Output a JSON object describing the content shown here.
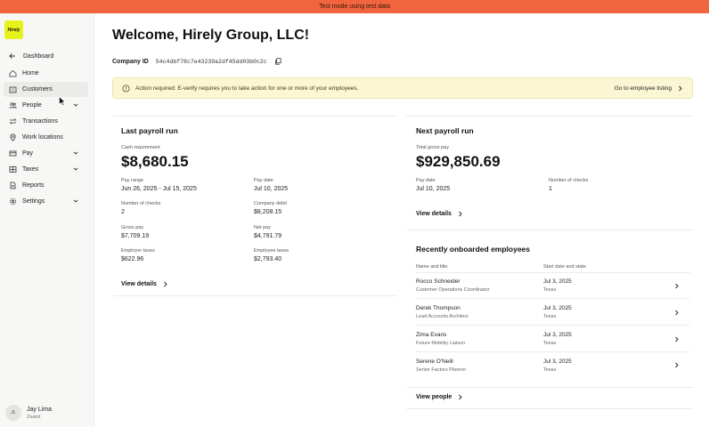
{
  "banner": "Test mode using test data",
  "logo_text": "Hirely",
  "sidebar": {
    "back_label": "Dashboard",
    "items": [
      {
        "label": "Home",
        "icon": "home-icon"
      },
      {
        "label": "Customers",
        "icon": "building-icon"
      },
      {
        "label": "People",
        "icon": "people-icon"
      },
      {
        "label": "Transactions",
        "icon": "transactions-icon"
      },
      {
        "label": "Work locations",
        "icon": "location-icon"
      },
      {
        "label": "Pay",
        "icon": "pay-icon"
      },
      {
        "label": "Taxes",
        "icon": "taxes-icon"
      },
      {
        "label": "Reports",
        "icon": "reports-icon"
      },
      {
        "label": "Settings",
        "icon": "gear-icon"
      }
    ],
    "user": {
      "initials": "JL",
      "name": "Jay Lima",
      "role": "Zealot"
    }
  },
  "header": {
    "title": "Welcome, Hirely Group, LLC!",
    "company_id_label": "Company ID",
    "company_id": "54c4dbf78c7e43239a2df45dd03b0c2c"
  },
  "alert": {
    "text": "Action required: E-verify requires you to take action for one or more of your employees.",
    "link": "Go to employee listing"
  },
  "last_payroll": {
    "title": "Last payroll run",
    "cash_label": "Cash requirement",
    "cash_value": "$8,680.15",
    "fields": [
      {
        "label": "Pay range",
        "value": "Jun 26, 2025 - Jul 15, 2025"
      },
      {
        "label": "Pay date",
        "value": "Jul 10, 2025"
      },
      {
        "label": "Number of checks",
        "value": "2"
      },
      {
        "label": "Company debit",
        "value": "$8,208.15"
      },
      {
        "label": "Gross pay",
        "value": "$7,709.19"
      },
      {
        "label": "Net pay",
        "value": "$4,791.79"
      },
      {
        "label": "Employer taxes",
        "value": "$622.96"
      },
      {
        "label": "Employee taxes",
        "value": "$2,793.40"
      }
    ],
    "link": "View details"
  },
  "next_payroll": {
    "title": "Next payroll run",
    "gross_label": "Total gross pay",
    "gross_value": "$929,850.69",
    "fields": [
      {
        "label": "Pay date",
        "value": "Jul 10, 2025"
      },
      {
        "label": "Number of checks",
        "value": "1"
      }
    ],
    "link": "View details"
  },
  "recent": {
    "title": "Recently onboarded employees",
    "col_name": "Name and title",
    "col_start": "Start date and state",
    "employees": [
      {
        "name": "Rocco Schneider",
        "title": "Customer Operations Coordinator",
        "date": "Jul 3, 2025",
        "state": "Texas"
      },
      {
        "name": "Derek Thompson",
        "title": "Lead Accounts Architect",
        "date": "Jul 3, 2025",
        "state": "Texas"
      },
      {
        "name": "Zima Evans",
        "title": "Future Mobility Liaison",
        "date": "Jul 3, 2025",
        "state": "Texas"
      },
      {
        "name": "Serene O'Neill",
        "title": "Senior Factors Planner",
        "date": "Jul 3, 2025",
        "state": "Texas"
      }
    ],
    "link": "View people"
  }
}
